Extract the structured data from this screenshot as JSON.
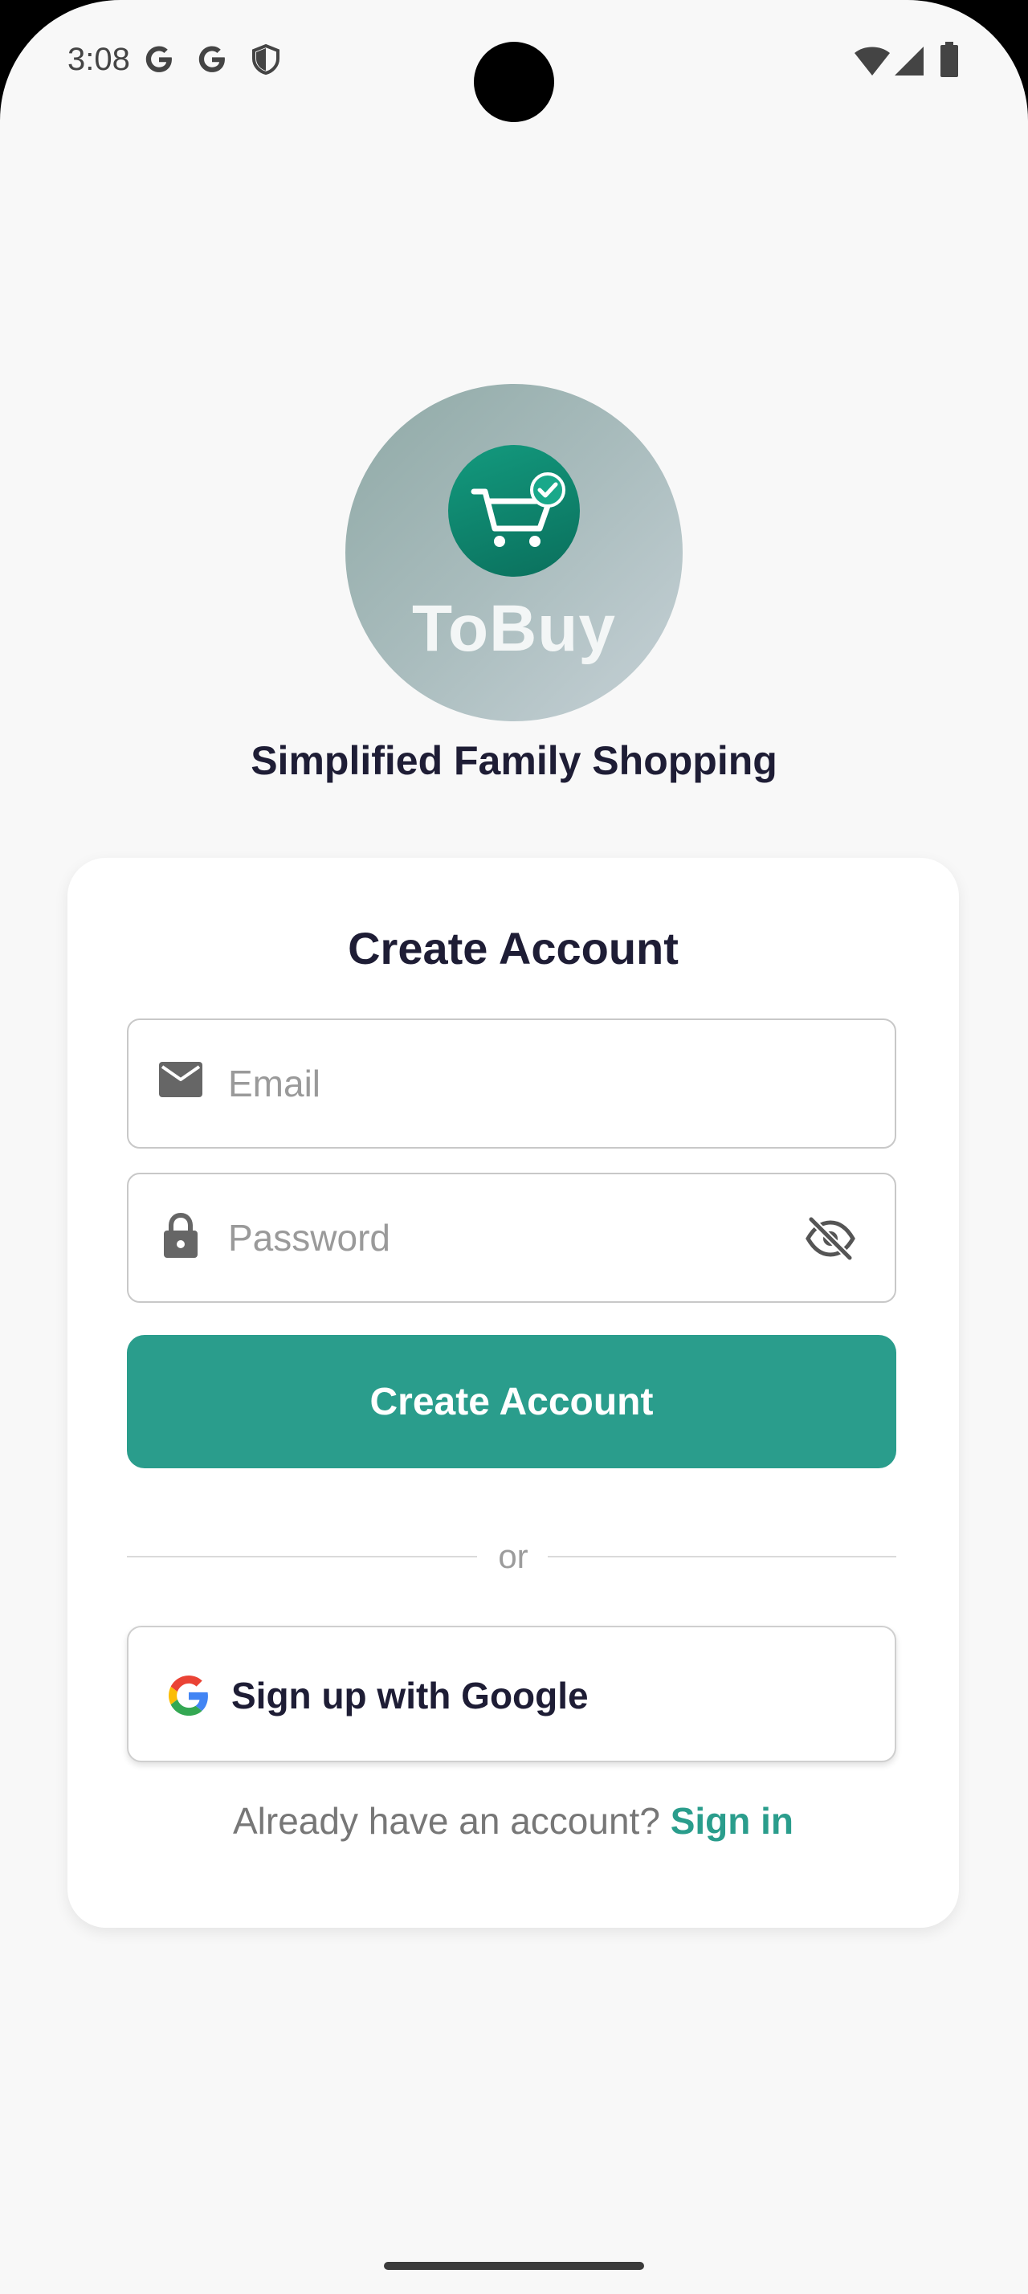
{
  "status_bar": {
    "time": "3:08",
    "icons": [
      "google-icon",
      "google-icon",
      "shield-icon",
      "wifi-icon",
      "signal-icon",
      "battery-icon"
    ]
  },
  "branding": {
    "logo_text": "ToBuy",
    "tagline": "Simplified Family Shopping"
  },
  "form": {
    "title": "Create Account",
    "email_placeholder": "Email",
    "password_placeholder": "Password",
    "submit_label": "Create Account",
    "divider_text": "or",
    "google_label": "Sign up with Google",
    "signin_prompt": "Already have an account?",
    "signin_link": "Sign in"
  },
  "colors": {
    "accent": "#2a9d8c",
    "title_text": "#1e1d35",
    "logo_badge": "#0f8a72"
  }
}
